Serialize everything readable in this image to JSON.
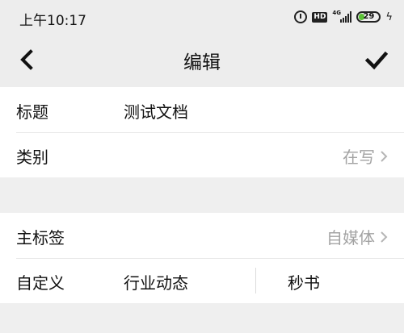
{
  "status_bar": {
    "time": "上午10:17",
    "hd_label": "HD",
    "network": "4G",
    "battery_level": 29,
    "battery_text": "29",
    "battery_color": "#5bc236"
  },
  "nav": {
    "title": "编辑",
    "back_icon": "chevron-left-icon",
    "confirm_icon": "checkmark-icon"
  },
  "form": {
    "title_label": "标题",
    "title_value": "测试文档",
    "category_label": "类别",
    "category_value": "在写",
    "main_tag_label": "主标签",
    "main_tag_value": "自媒体",
    "custom_label": "自定义",
    "custom_tags": [
      "行业动态",
      "秒书"
    ]
  }
}
